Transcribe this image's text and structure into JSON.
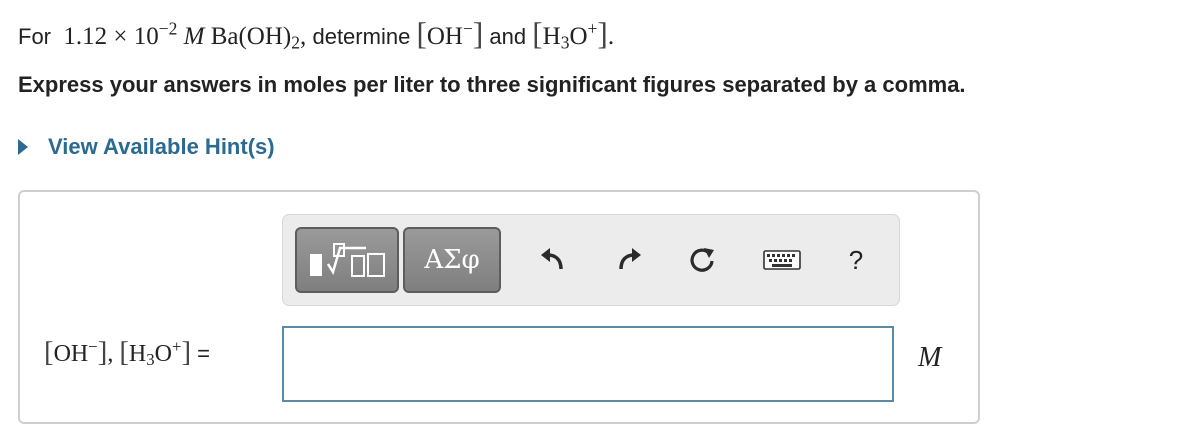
{
  "question": {
    "prefix": "For",
    "mantissa": "1.12",
    "times": "×",
    "base": "10",
    "exponent": "−2",
    "molar_unit": "M",
    "compound_main": "Ba(OH)",
    "compound_sub": "2",
    "comma": ",",
    "verb": "determine",
    "species1": "OH",
    "species1_charge": "−",
    "conjunction": "and",
    "species2_a": "H",
    "species2_sub": "3",
    "species2_b": "O",
    "species2_charge": "+",
    "period": "."
  },
  "instruction": "Express your answers in moles per liter to three significant figures separated by a comma.",
  "hint_link": "View Available Hint(s)",
  "toolbar": {
    "greek_label": "ΑΣφ",
    "help_label": "?",
    "icons": [
      "templates-icon",
      "greek-symbols-button",
      "undo-icon",
      "redo-icon",
      "reset-icon",
      "keyboard-icon",
      "help-icon"
    ]
  },
  "answer": {
    "label_species1": "OH",
    "label_charge1": "−",
    "label_sep": ",",
    "label_species2_a": "H",
    "label_species2_sub": "3",
    "label_species2_b": "O",
    "label_charge2": "+",
    "label_equals": "=",
    "input_value": "",
    "unit": "M"
  }
}
